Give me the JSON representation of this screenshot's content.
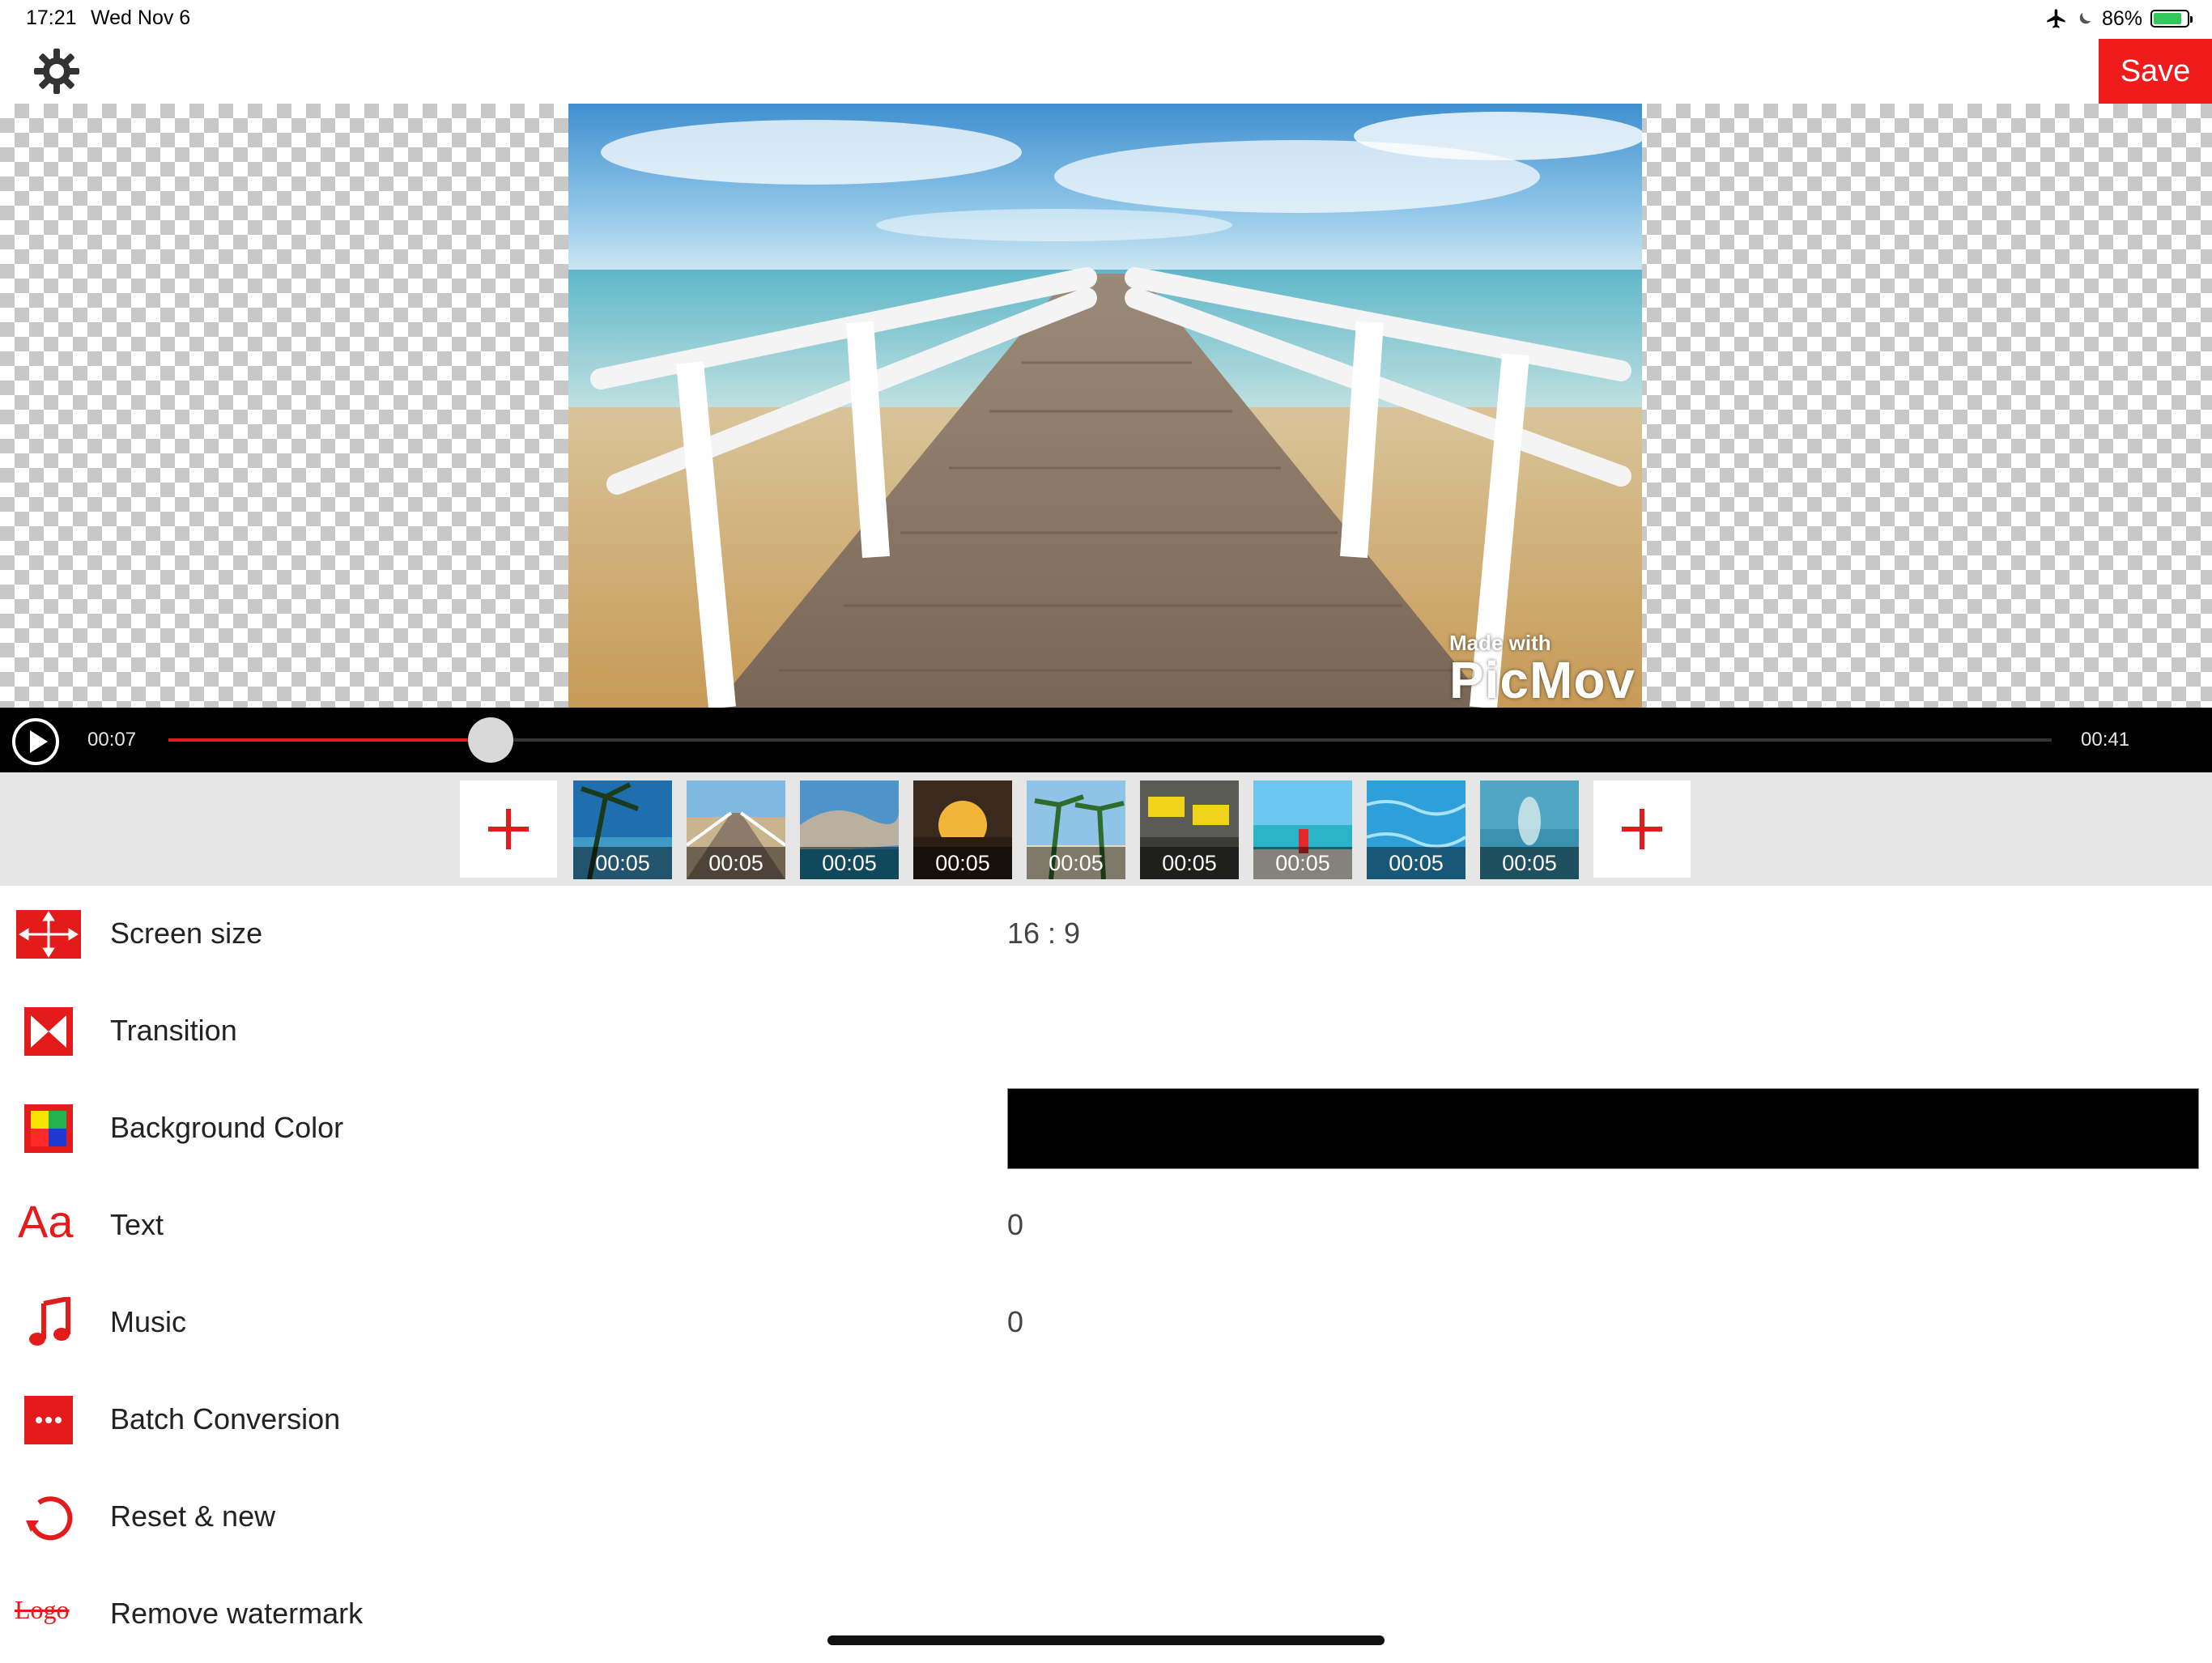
{
  "status_bar": {
    "time": "17:21",
    "date": "Wed Nov 6",
    "battery": "86%",
    "battery_level": 0.86
  },
  "toolbar": {
    "settings_icon": "gear-icon",
    "save_label": "Save"
  },
  "preview": {
    "image": "boardwalk-pier-over-beach-photo",
    "watermark_small": "Made with",
    "watermark_big": "PicMov"
  },
  "player": {
    "current_time": "00:07",
    "total_time": "00:41",
    "progress": 0.171,
    "accent": "#e41b1b"
  },
  "clips": [
    {
      "duration": "00:05",
      "scene": "palm-tree-ocean"
    },
    {
      "duration": "00:05",
      "scene": "pier"
    },
    {
      "duration": "00:05",
      "scene": "cliff-cove"
    },
    {
      "duration": "00:05",
      "scene": "sunset-toast"
    },
    {
      "duration": "00:05",
      "scene": "beach-palms"
    },
    {
      "duration": "00:05",
      "scene": "airport-signs"
    },
    {
      "duration": "00:05",
      "scene": "beach-drink"
    },
    {
      "duration": "00:05",
      "scene": "pool-water"
    },
    {
      "duration": "00:05",
      "scene": "hands-underwater"
    }
  ],
  "settings": {
    "screen_size": {
      "label": "Screen size",
      "value": "16 : 9",
      "icon": "resize-arrows-icon"
    },
    "transition": {
      "label": "Transition",
      "icon": "transition-icon"
    },
    "background_color": {
      "label": "Background Color",
      "value_color": "#000000",
      "icon": "color-palette-icon"
    },
    "text": {
      "label": "Text",
      "value": "0",
      "icon_text": "Aa"
    },
    "music": {
      "label": "Music",
      "value": "0",
      "icon": "music-note-icon"
    },
    "batch": {
      "label": "Batch Conversion",
      "icon": "batch-dots-icon"
    },
    "reset": {
      "label": "Reset & new",
      "icon": "reset-arrow-icon"
    },
    "watermark": {
      "label": "Remove watermark",
      "icon_text": "Logo"
    }
  },
  "colors": {
    "brand_red": "#e41b1b",
    "save_red": "#ee1c1c"
  }
}
